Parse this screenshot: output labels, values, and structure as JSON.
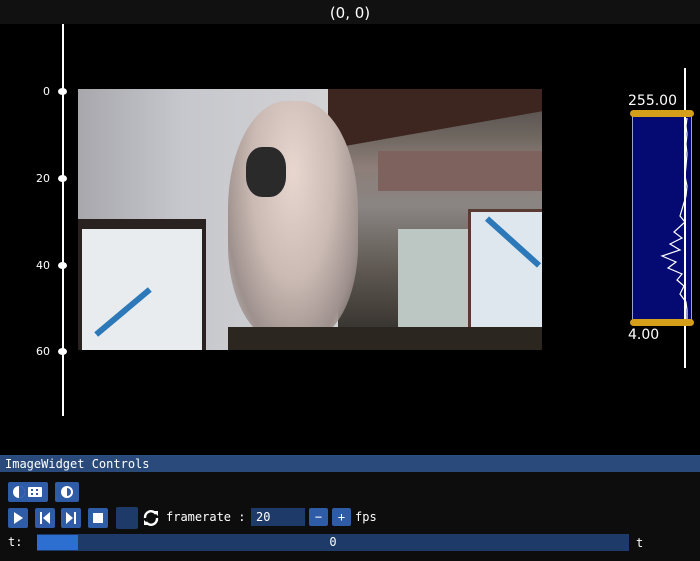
{
  "plot": {
    "coords_text": "(0, 0)",
    "y_ticks": [
      "0",
      "20",
      "40",
      "60"
    ],
    "histogram": {
      "max_label": "255.00",
      "min_label": "4.00"
    }
  },
  "controls": {
    "title": "ImageWidget Controls",
    "framerate_label": "framerate :",
    "framerate_value": "20",
    "minus_label": "−",
    "plus_label": "+",
    "fps_label": "fps",
    "t_label": "t:",
    "slider_value": "0",
    "slider_progress": 0.07,
    "slider_end_label": "t"
  },
  "colors": {
    "accent": "#2f5ca6",
    "title_bar": "#294a7a",
    "histogram_bg": "#050a72",
    "handle": "#d59f1a"
  }
}
